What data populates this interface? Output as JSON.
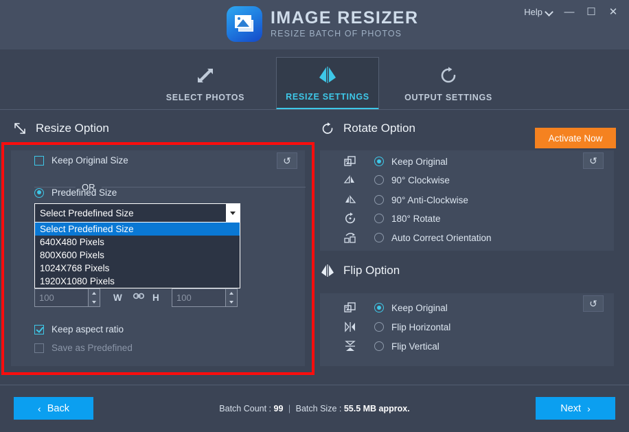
{
  "window": {
    "app_title": "IMAGE RESIZER",
    "app_subtitle": "RESIZE BATCH OF PHOTOS",
    "help_label": "Help",
    "minimize_glyph": "—",
    "maximize_glyph": "☐",
    "close_glyph": "✕",
    "accent_cyan": "#3ec8e8",
    "accent_orange": "#f58220",
    "accent_blue": "#0b9ff0",
    "highlight_red": "#fd0d0d",
    "bg": "#3b4455",
    "titlebar_bg": "#454f62",
    "panel_bg": "#414b5d"
  },
  "tabs": [
    {
      "label": "SELECT PHOTOS",
      "icon": "resize-diagonal-arrows-icon",
      "active": false
    },
    {
      "label": "RESIZE SETTINGS",
      "icon": "flip-horizontal-icon",
      "active": true
    },
    {
      "label": "OUTPUT SETTINGS",
      "icon": "rotate-clockwise-icon",
      "active": false
    }
  ],
  "activate_button": {
    "label": "Activate Now"
  },
  "resize_section": {
    "title": "Resize Option",
    "icon": "resize-diagonal-arrows-icon",
    "reset_glyph": "↺",
    "keep_original_size": {
      "label": "Keep Original Size",
      "checked": false
    },
    "or_label": "OR",
    "predefined_size": {
      "label": "Predefined Size",
      "selected": true
    },
    "dropdown": {
      "value": "Select Predefined Size",
      "open": true,
      "options": [
        "Select Predefined Size",
        "640X480 Pixels",
        "800X600 Pixels",
        "1024X768 Pixels",
        "1920X1080 Pixels"
      ],
      "highlighted_index": 0
    },
    "width_field": {
      "value": "100",
      "label": "W"
    },
    "height_field": {
      "value": "100",
      "label": "H"
    },
    "link_icon": "chain-link-icon",
    "keep_aspect_ratio": {
      "label": "Keep aspect ratio",
      "checked": true,
      "disabled": false
    },
    "save_as_predefined": {
      "label": "Save as Predefined",
      "checked": false,
      "disabled": true
    }
  },
  "rotate_section": {
    "title": "Rotate Option",
    "icon": "rotate-clockwise-icon",
    "reset_glyph": "↺",
    "options": [
      {
        "label": "Keep Original",
        "icon": "keep-original-icon",
        "selected": true
      },
      {
        "label": "90° Clockwise",
        "icon": "rotate-cw-90-icon",
        "selected": false
      },
      {
        "label": "90° Anti-Clockwise",
        "icon": "rotate-ccw-90-icon",
        "selected": false
      },
      {
        "label": "180° Rotate",
        "icon": "rotate-180-icon",
        "selected": false
      },
      {
        "label": "Auto Correct Orientation",
        "icon": "auto-orientation-icon",
        "selected": false
      }
    ]
  },
  "flip_section": {
    "title": "Flip Option",
    "icon": "flip-horizontal-icon",
    "reset_glyph": "↺",
    "options": [
      {
        "label": "Keep Original",
        "icon": "keep-original-icon",
        "selected": true
      },
      {
        "label": "Flip Horizontal",
        "icon": "flip-horizontal-icon",
        "selected": false
      },
      {
        "label": "Flip Vertical",
        "icon": "flip-vertical-icon",
        "selected": false
      }
    ]
  },
  "footer": {
    "back_button": "Back",
    "next_button": "Next",
    "back_arrow": "‹",
    "next_arrow": "›",
    "batch_count_label": "Batch Count :",
    "batch_count_value": "99",
    "separator": "|",
    "batch_size_label": "Batch Size :",
    "batch_size_value": "55.5 MB approx."
  }
}
